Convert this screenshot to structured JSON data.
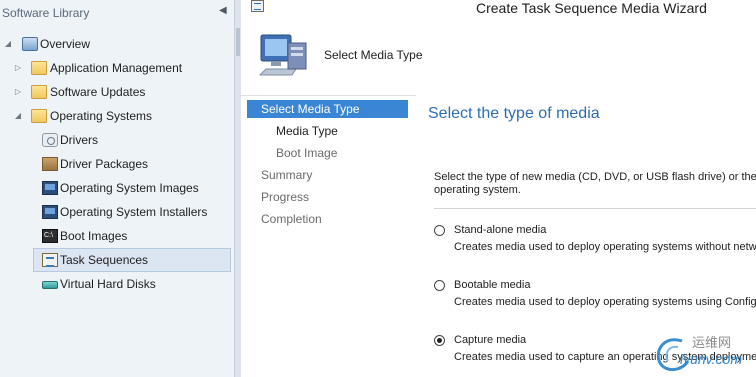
{
  "nav": {
    "header": "Software Library",
    "collapse_glyph": "◀",
    "items": [
      {
        "label": "Overview",
        "icon": "overview-icon",
        "expanded": true
      },
      {
        "label": "Application Management",
        "icon": "folder-icon",
        "expanded": false
      },
      {
        "label": "Software Updates",
        "icon": "folder-icon",
        "expanded": false
      },
      {
        "label": "Operating Systems",
        "icon": "folder-icon",
        "expanded": true
      },
      {
        "label": "Drivers",
        "icon": "driver-icon"
      },
      {
        "label": "Driver Packages",
        "icon": "package-icon"
      },
      {
        "label": "Operating System Images",
        "icon": "os-image-icon"
      },
      {
        "label": "Operating System Installers",
        "icon": "os-installer-icon"
      },
      {
        "label": "Boot Images",
        "icon": "boot-image-icon"
      },
      {
        "label": "Task Sequences",
        "icon": "task-sequence-icon",
        "selected": true
      },
      {
        "label": "Virtual Hard Disks",
        "icon": "virtual-disk-icon"
      }
    ]
  },
  "wizard": {
    "title": "Create Task Sequence Media Wizard",
    "banner_heading": "Select Media Type",
    "steps": [
      {
        "label": "Select Media Type",
        "state": "active"
      },
      {
        "label": "Media Type",
        "state": "current-sub"
      },
      {
        "label": "Boot Image",
        "state": "sub"
      },
      {
        "label": "Summary",
        "state": "pending"
      },
      {
        "label": "Progress",
        "state": "pending"
      },
      {
        "label": "Completion",
        "state": "pending"
      }
    ],
    "content": {
      "title": "Select the type of media",
      "description": "Select the type of new media (CD, DVD, or USB flash drive) or the fi\noperating system.",
      "options": [
        {
          "label": "Stand-alone media",
          "desc": "Creates media used to deploy operating systems without network",
          "selected": false
        },
        {
          "label": "Bootable media",
          "desc": "Creates media used to deploy operating systems using ConfigMg",
          "selected": false
        },
        {
          "label": "Capture media",
          "desc": "Creates media used to capture an operating system deployment i",
          "selected": true
        }
      ]
    }
  },
  "watermark": {
    "text_cn": "运维网",
    "text_en": "iyunv.com"
  },
  "colors": {
    "accent": "#3a86d4",
    "content_title": "#2d6eb2",
    "nav_bg": "#eef3f8"
  }
}
